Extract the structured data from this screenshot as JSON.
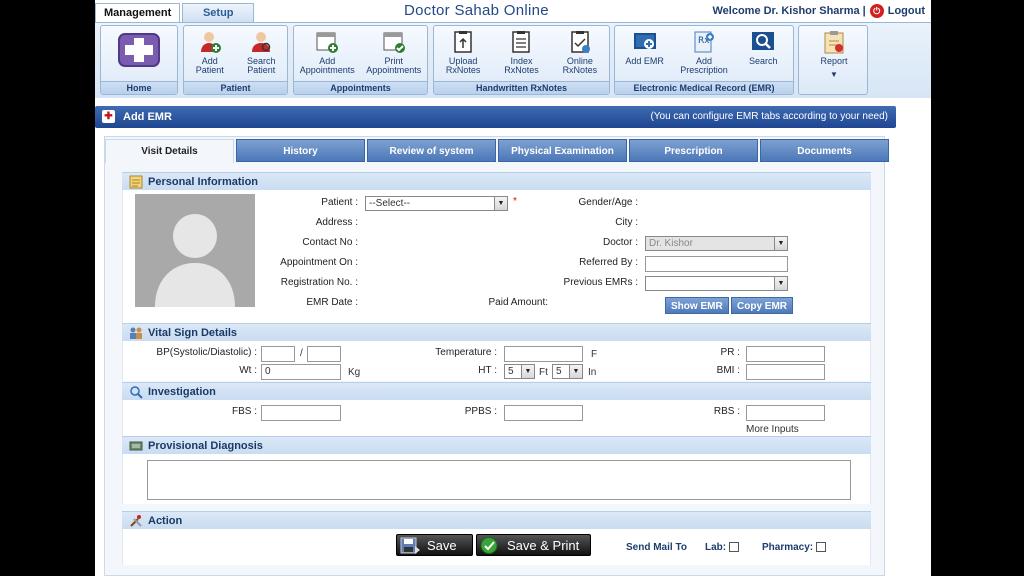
{
  "nav": {
    "tabs": [
      "Management",
      "Setup"
    ]
  },
  "header": {
    "title": "Doctor Sahab Online",
    "welcome": "Welcome Dr. Kishor Sharma |",
    "logout": "Logout"
  },
  "ribbon": {
    "home": {
      "button": "Home"
    },
    "patient": {
      "group": "Patient",
      "add": "Add\nPatient",
      "search": "Search\nPatient"
    },
    "appointments": {
      "group": "Appointments",
      "add": "Add\nAppointments",
      "print": "Print\nAppointments"
    },
    "rxnotes": {
      "group": "Handwritten RxNotes",
      "upload": "Upload\nRxNotes",
      "index": "Index\nRxNotes",
      "online": "Online\nRxNotes"
    },
    "emr": {
      "group": "Electronic Medical Record (EMR)",
      "add": "Add EMR",
      "prescription": "Add\nPrescription",
      "search": "Search"
    },
    "report": {
      "button": "Report",
      "arrow": "▼"
    }
  },
  "titlebar": {
    "title": "Add EMR",
    "hint": "(You can configure EMR tabs according to your need)"
  },
  "emr_tabs": [
    "Visit Details",
    "History",
    "Review of system",
    "Physical Examination",
    "Prescription",
    "Documents"
  ],
  "personal": {
    "heading": "Personal Information",
    "patient_label": "Patient :",
    "patient_value": "--Select--",
    "address_label": "Address :",
    "contact_label": "Contact No :",
    "appointment_label": "Appointment On :",
    "registration_label": "Registration No. :",
    "emrdate_label": "EMR Date :",
    "paid_label": "Paid Amount:",
    "gender_label": "Gender/Age :",
    "city_label": "City :",
    "doctor_label": "Doctor :",
    "doctor_value": "Dr. Kishor",
    "referred_label": "Referred By :",
    "previous_label": "Previous EMRs :",
    "show_emr": "Show EMR",
    "copy_emr": "Copy EMR",
    "required_mark": "*"
  },
  "vitals": {
    "heading": "Vital Sign Details",
    "bp_label": "BP(Systolic/Diastolic) :",
    "bp_sep": "/",
    "temp_label": "Temperature :",
    "temp_unit": "F",
    "pr_label": "PR :",
    "wt_label": "Wt :",
    "wt_value": "0",
    "wt_unit": "Kg",
    "ht_label": "HT :",
    "ht_ft": "5",
    "ht_ft_unit": "Ft",
    "ht_in": "5",
    "ht_in_unit": "In",
    "bmi_label": "BMI :"
  },
  "investigation": {
    "heading": "Investigation",
    "fbs_label": "FBS :",
    "ppbs_label": "PPBS :",
    "rbs_label": "RBS :",
    "more": "More Inputs"
  },
  "diagnosis": {
    "heading": "Provisional Diagnosis"
  },
  "action": {
    "heading": "Action",
    "save": "Save",
    "save_print": "Save & Print",
    "send_mail": "Send Mail To",
    "lab": "Lab:",
    "pharmacy": "Pharmacy:"
  },
  "colors": {
    "accent": "#1f4590",
    "tab": "#4c78b8",
    "logout": "#d21f1f"
  }
}
